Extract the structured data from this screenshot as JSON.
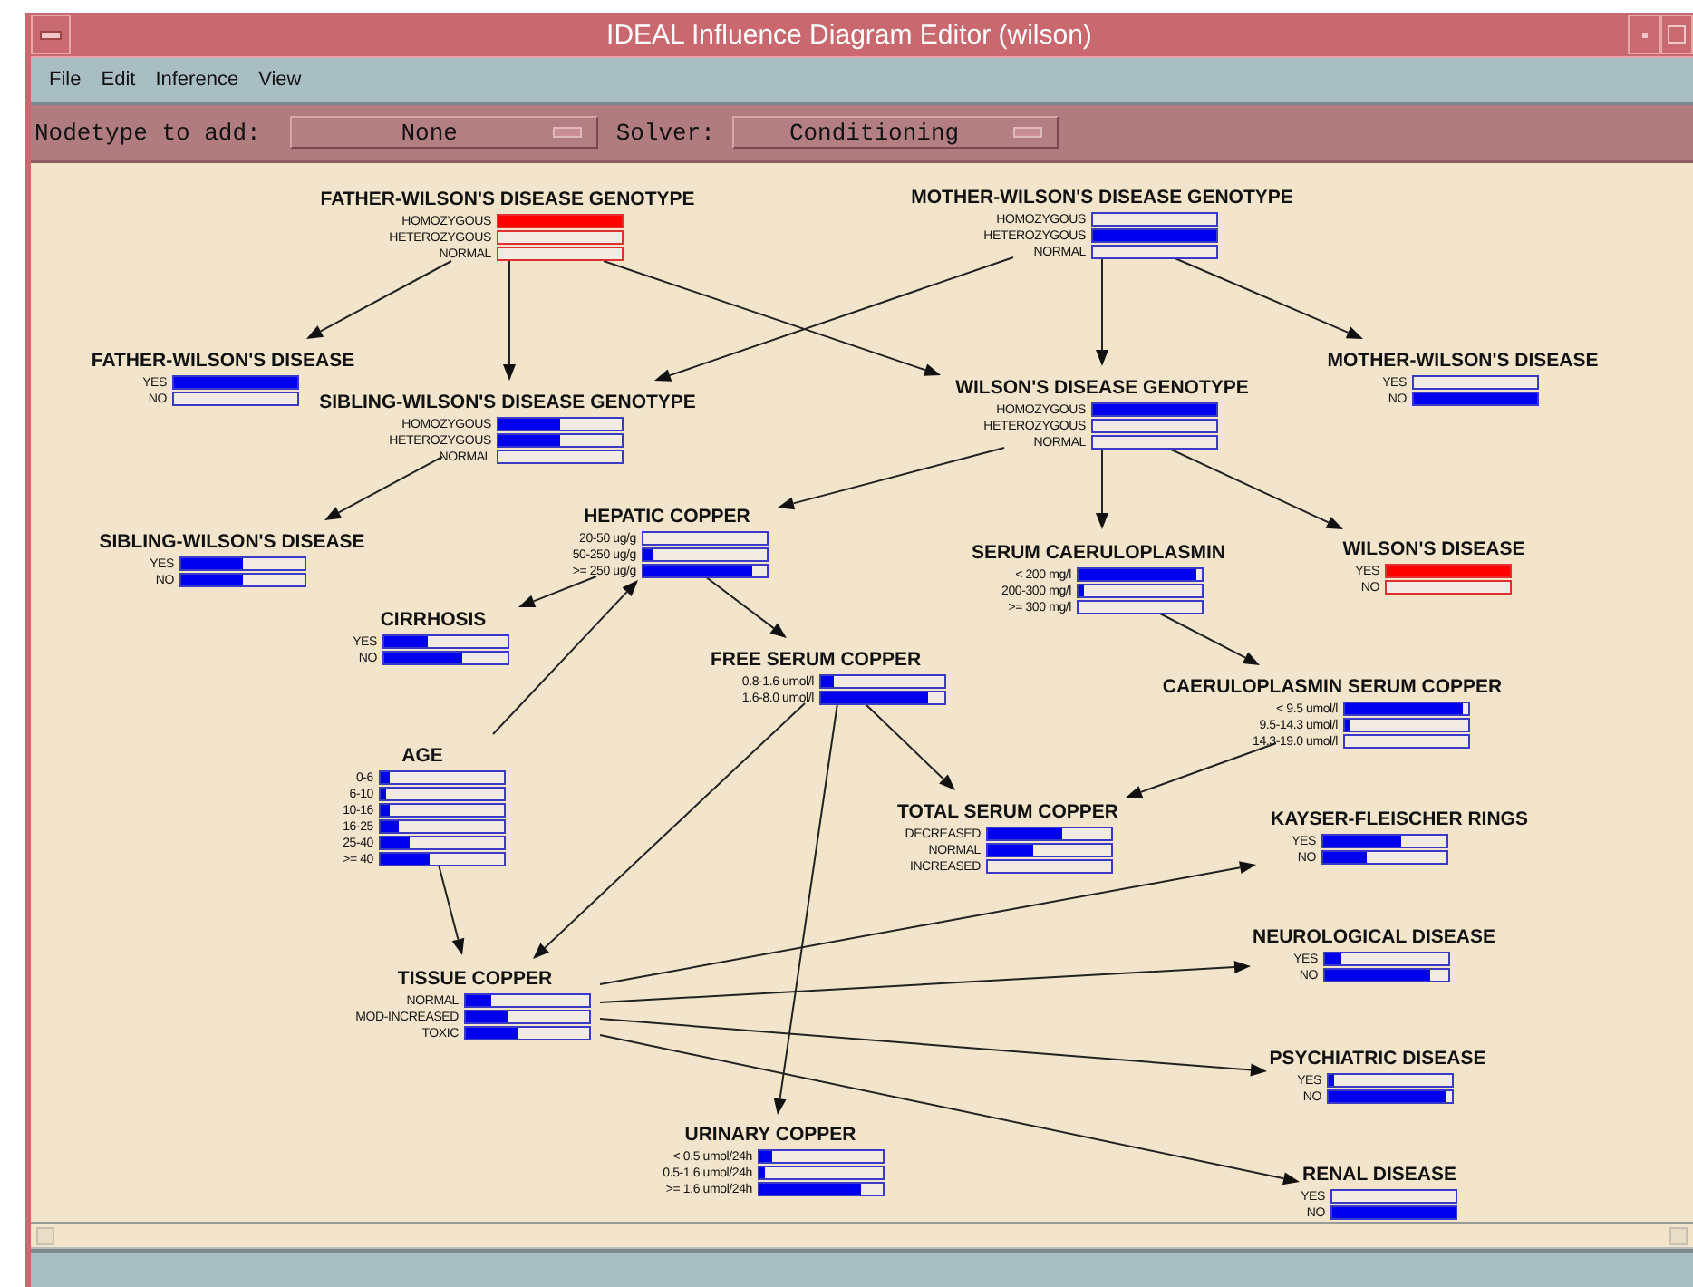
{
  "window": {
    "title": "IDEAL Influence Diagram Editor (wilson)"
  },
  "menu": [
    {
      "label": "File"
    },
    {
      "label": "Edit"
    },
    {
      "label": "Inference"
    },
    {
      "label": "View"
    }
  ],
  "toolbar": {
    "nodetype_label": "Nodetype to add:",
    "nodetype_value": "None",
    "solver_label": "Solver:",
    "solver_value": "Conditioning"
  },
  "nodes": [
    {
      "title": "FATHER-WILSON'S DISEASE GENOTYPE",
      "observed": true,
      "states": [
        {
          "label": "HOMOZYGOUS",
          "level": 1
        },
        {
          "label": "HETEROZYGOUS"
        },
        {
          "label": "NORMAL"
        }
      ]
    },
    {
      "title": "MOTHER-WILSON'S DISEASE GENOTYPE",
      "observed": false,
      "states": [
        {
          "label": "HOMOZYGOUS"
        },
        {
          "label": "HETEROZYGOUS",
          "level": 1
        },
        {
          "label": "NORMAL"
        }
      ]
    },
    {
      "title": "FATHER-WILSON'S DISEASE",
      "observed": false,
      "states": [
        {
          "label": "YES",
          "level": 1
        },
        {
          "label": "NO"
        }
      ]
    },
    {
      "title": "MOTHER-WILSON'S DISEASE",
      "observed": false,
      "states": [
        {
          "label": "YES"
        },
        {
          "label": "NO",
          "level": 1
        }
      ]
    },
    {
      "title": "SIBLING-WILSON'S DISEASE GENOTYPE",
      "observed": false,
      "states": [
        {
          "label": "HOMOZYGOUS",
          "level": 0.5
        },
        {
          "label": "HETEROZYGOUS",
          "level": 0.5
        },
        {
          "label": "NORMAL"
        }
      ]
    },
    {
      "title": "WILSON'S DISEASE GENOTYPE",
      "observed": false,
      "states": [
        {
          "label": "HOMOZYGOUS",
          "level": 1
        },
        {
          "label": "HETEROZYGOUS"
        },
        {
          "label": "NORMAL"
        }
      ]
    },
    {
      "title": "SIBLING-WILSON'S DISEASE",
      "observed": false,
      "states": [
        {
          "label": "YES",
          "level": 0.5
        },
        {
          "label": "NO",
          "level": 0.5
        }
      ]
    },
    {
      "title": "HEPATIC COPPER",
      "observed": false,
      "states": [
        {
          "label": "20-50 ug/g"
        },
        {
          "label": "50-250 ug/g",
          "level": 0.07
        },
        {
          "label": ">= 250 ug/g",
          "level": 0.88
        }
      ]
    },
    {
      "title": "SERUM CAERULOPLASMIN",
      "observed": false,
      "states": [
        {
          "label": "< 200 mg/l",
          "level": 0.95
        },
        {
          "label": "200-300 mg/l",
          "level": 0.04
        },
        {
          "label": ">= 300 mg/l"
        }
      ]
    },
    {
      "title": "WILSON'S DISEASE",
      "observed": true,
      "states": [
        {
          "label": "YES",
          "level": 1
        },
        {
          "label": "NO"
        }
      ]
    },
    {
      "title": "CIRRHOSIS",
      "observed": false,
      "states": [
        {
          "label": "YES",
          "level": 0.35
        },
        {
          "label": "NO",
          "level": 0.63
        }
      ]
    },
    {
      "title": "FREE SERUM COPPER",
      "observed": false,
      "states": [
        {
          "label": "0.8-1.6 umol/l",
          "level": 0.1
        },
        {
          "label": "1.6-8.0 umol/l",
          "level": 0.87
        }
      ]
    },
    {
      "title": "CAERULOPLASMIN SERUM COPPER",
      "observed": false,
      "states": [
        {
          "label": "< 9.5 umol/l",
          "level": 0.95
        },
        {
          "label": "9.5-14.3 umol/l",
          "level": 0.05
        },
        {
          "label": "14.3-19.0 umol/l"
        }
      ]
    },
    {
      "title": "AGE",
      "observed": false,
      "states": [
        {
          "label": "0-6",
          "level": 0.07
        },
        {
          "label": "6-10",
          "level": 0.04
        },
        {
          "label": "10-16",
          "level": 0.07
        },
        {
          "label": "16-25",
          "level": 0.14
        },
        {
          "label": "25-40",
          "level": 0.23
        },
        {
          "label": ">= 40",
          "level": 0.4
        }
      ]
    },
    {
      "title": "TOTAL SERUM COPPER",
      "observed": false,
      "states": [
        {
          "label": "DECREASED",
          "level": 0.6
        },
        {
          "label": "NORMAL",
          "level": 0.37
        },
        {
          "label": "INCREASED"
        }
      ]
    },
    {
      "title": "KAYSER-FLEISCHER RINGS",
      "observed": false,
      "states": [
        {
          "label": "YES",
          "level": 0.63
        },
        {
          "label": "NO",
          "level": 0.35
        }
      ]
    },
    {
      "title": "NEUROLOGICAL DISEASE",
      "observed": false,
      "states": [
        {
          "label": "YES",
          "level": 0.13
        },
        {
          "label": "NO",
          "level": 0.85
        }
      ]
    },
    {
      "title": "TISSUE COPPER",
      "observed": false,
      "states": [
        {
          "label": "NORMAL",
          "level": 0.2
        },
        {
          "label": "MOD-INCREASED",
          "level": 0.34
        },
        {
          "label": "TOXIC",
          "level": 0.43
        }
      ]
    },
    {
      "title": "PSYCHIATRIC DISEASE",
      "observed": false,
      "states": [
        {
          "label": "YES",
          "level": 0.05
        },
        {
          "label": "NO",
          "level": 0.95
        }
      ]
    },
    {
      "title": "URINARY COPPER",
      "observed": false,
      "states": [
        {
          "label": "< 0.5 umol/24h",
          "level": 0.1
        },
        {
          "label": "0.5-1.6 umol/24h",
          "level": 0.05
        },
        {
          "label": ">= 1.6 umol/24h",
          "level": 0.83
        }
      ]
    },
    {
      "title": "RENAL DISEASE",
      "observed": false,
      "states": [
        {
          "label": "YES"
        },
        {
          "label": "NO",
          "level": 1
        }
      ]
    }
  ]
}
